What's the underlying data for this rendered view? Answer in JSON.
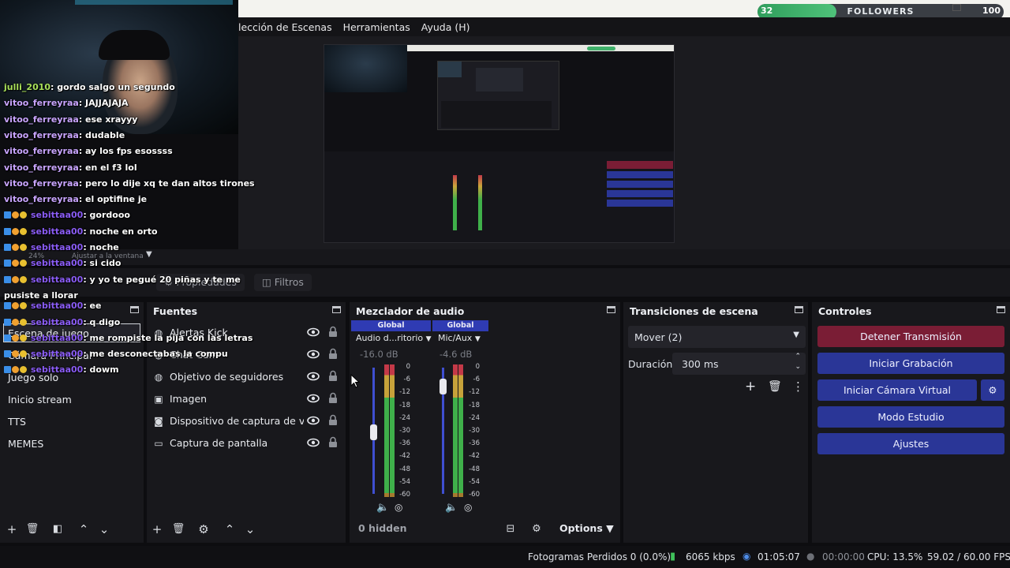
{
  "menu": {
    "items": [
      "lección de Escenas",
      "Herramientas",
      "Ayuda (H)"
    ]
  },
  "followers": {
    "current": "32",
    "label": "FOLLOWERS",
    "goal": "100",
    "progress": 0.32
  },
  "preview": {
    "zoom_label": "24%",
    "fit_label": "Ajustar a la ventana"
  },
  "properties_bar": {
    "properties_label": "Propiedades",
    "filters_label": "Filtros"
  },
  "scenes": {
    "items": [
      "Escena de juego",
      "Cámara Principal",
      "Juego solo",
      "Inicio stream",
      "TTS",
      "MEMES"
    ]
  },
  "sources": {
    "title": "Fuentes",
    "items": [
      {
        "name": "Alertas Kick",
        "icon": "globe-icon"
      },
      {
        "name": "Chat Cam",
        "icon": "globe-icon"
      },
      {
        "name": "Objetivo de seguidores",
        "icon": "globe-icon"
      },
      {
        "name": "Imagen",
        "icon": "image-icon"
      },
      {
        "name": "Dispositivo de captura de vide",
        "icon": "camera-icon"
      },
      {
        "name": "Captura de pantalla",
        "icon": "monitor-icon"
      }
    ]
  },
  "mixer": {
    "title": "Mezclador de audio",
    "channels": [
      {
        "tag": "Global",
        "name": "Audio d...ritorio",
        "db": "-16.0 dB",
        "volume": 0.49
      },
      {
        "tag": "Global",
        "name": "Mic/Aux",
        "db": "-4.6 dB",
        "volume": 0.85
      }
    ],
    "ticks": [
      "0",
      "-6",
      "-12",
      "-18",
      "-24",
      "-30",
      "-36",
      "-42",
      "-48",
      "-54",
      "-60"
    ],
    "hidden_label": "0 hidden",
    "options_label": "Options"
  },
  "transitions": {
    "title": "Transiciones de escena",
    "selected": "Mover (2)",
    "duration_label": "Duración",
    "duration_value": "300 ms"
  },
  "controls": {
    "title": "Controles",
    "stop_stream": "Detener Transmisión",
    "start_recording": "Iniciar Grabación",
    "start_virtual_cam": "Iniciar Cámara Virtual",
    "studio_mode": "Modo Estudio",
    "settings": "Ajustes"
  },
  "chat": {
    "messages": [
      {
        "user": "julli_2010",
        "text": ": gordo salgo un segundo",
        "badges": false,
        "color": "#a8e05a"
      },
      {
        "user": "vitoo_ferreyraa",
        "text": ": JAJJAJAJA",
        "badges": false,
        "color": "#c9a5ff"
      },
      {
        "user": "vitoo_ferreyraa",
        "text": ": ese xrayyy",
        "badges": false,
        "color": "#c9a5ff"
      },
      {
        "user": "vitoo_ferreyraa",
        "text": ": dudable",
        "badges": false,
        "color": "#c9a5ff"
      },
      {
        "user": "vitoo_ferreyraa",
        "text": ": ay los fps esossss",
        "badges": false,
        "color": "#c9a5ff"
      },
      {
        "user": "vitoo_ferreyraa",
        "text": ": en el f3 lol",
        "badges": false,
        "color": "#c9a5ff"
      },
      {
        "user": "vitoo_ferreyraa",
        "text": ": pero lo dije xq te dan altos tirones",
        "badges": false,
        "color": "#c9a5ff"
      },
      {
        "user": "vitoo_ferreyraa",
        "text": ": el optifine je",
        "badges": false,
        "color": "#c9a5ff"
      },
      {
        "user": "sebittaa00",
        "text": ": gordooo",
        "badges": true,
        "color": "#8a5cf5"
      },
      {
        "user": "sebittaa00",
        "text": ": noche en orto",
        "badges": true,
        "color": "#8a5cf5"
      },
      {
        "user": "sebittaa00",
        "text": ": noche",
        "badges": true,
        "color": "#8a5cf5"
      },
      {
        "user": "sebittaa00",
        "text": ": si cido",
        "badges": true,
        "color": "#8a5cf5"
      },
      {
        "user": "sebittaa00",
        "text": ": y yo te pegué 20 piñas y te me",
        "badges": true,
        "color": "#8a5cf5"
      },
      {
        "user": "",
        "text": "pusiste a llorar",
        "badges": false,
        "color": "#ffffff"
      },
      {
        "user": "sebittaa00",
        "text": ": ee",
        "badges": true,
        "color": "#8a5cf5"
      },
      {
        "user": "sebittaa00",
        "text": ": q digo",
        "badges": true,
        "color": "#8a5cf5"
      },
      {
        "user": "sebittaa00",
        "text": ": me rompiste la pija con las letras",
        "badges": true,
        "color": "#8a5cf5"
      },
      {
        "user": "sebittaa00",
        "text": ": me desconectabas la compu",
        "badges": true,
        "color": "#8a5cf5"
      },
      {
        "user": "sebittaa00",
        "text": ": dowm",
        "badges": true,
        "color": "#8a5cf5"
      }
    ]
  },
  "status": {
    "dropped_frames": "Fotogramas Perdidos 0 (0.0%)",
    "bitrate": "6065 kbps",
    "stream_time": "01:05:07",
    "rec_time": "00:00:00",
    "cpu": "CPU: 13.5%",
    "fps": "59.02 / 60.00 FPS"
  },
  "colors": {
    "stop_button": "#7a1d35",
    "control_button": "#2a3697",
    "global_tag": "#2f3bb3"
  }
}
